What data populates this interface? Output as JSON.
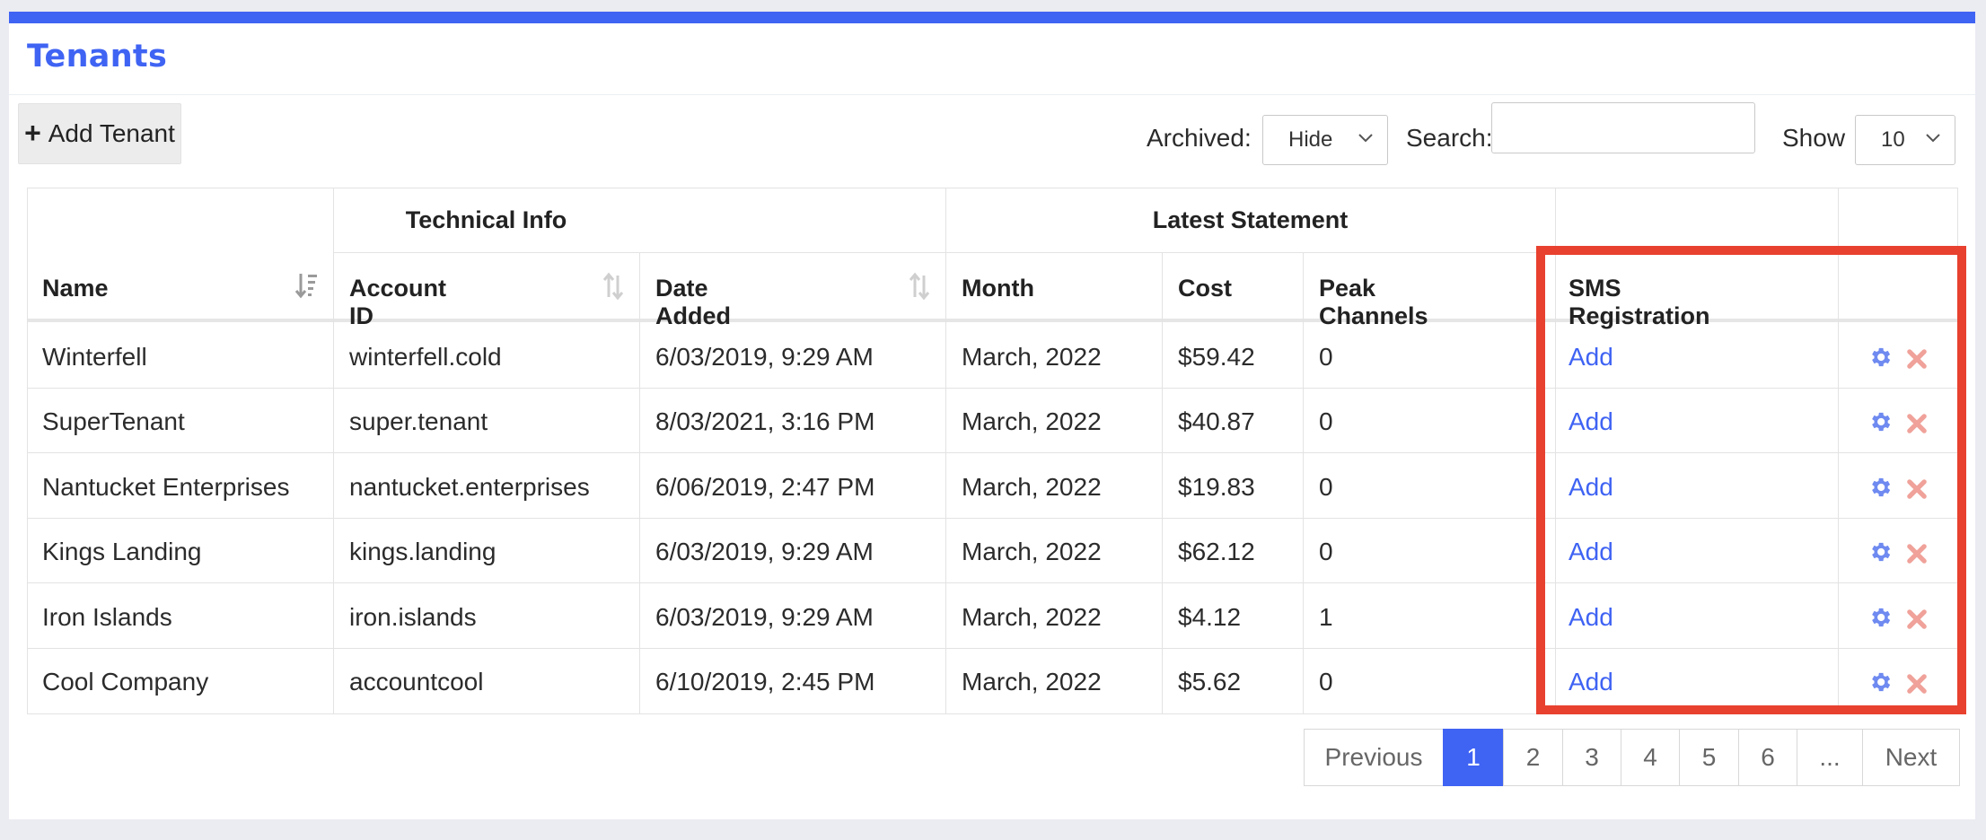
{
  "page": {
    "title": "Tenants"
  },
  "toolbar": {
    "add_label": "Add Tenant",
    "archived_label": "Archived:",
    "archived_value": "Hide",
    "search_label": "Search:",
    "search_value": "",
    "show_label": "Show",
    "show_value": "10"
  },
  "table": {
    "group_headers": {
      "technical": "Technical Info",
      "statement": "Latest Statement"
    },
    "columns": {
      "name": "Name",
      "account_id": "Account ID",
      "date_added": "Date Added",
      "month": "Month",
      "cost": "Cost",
      "peak_channels": "Peak Channels",
      "sms_registration": "SMS Registration"
    },
    "rows": [
      {
        "name": "Winterfell",
        "account_id": "winterfell.cold",
        "date_added": "6/03/2019, 9:29 AM",
        "month": "March, 2022",
        "cost": "$59.42",
        "peak": "0",
        "sms": "Add"
      },
      {
        "name": "SuperTenant",
        "account_id": "super.tenant",
        "date_added": "8/03/2021, 3:16 PM",
        "month": "March, 2022",
        "cost": "$40.87",
        "peak": "0",
        "sms": "Add"
      },
      {
        "name": "Nantucket Enterprises",
        "account_id": "nantucket.enterprises",
        "date_added": "6/06/2019, 2:47 PM",
        "month": "March, 2022",
        "cost": "$19.83",
        "peak": "0",
        "sms": "Add"
      },
      {
        "name": "Kings Landing",
        "account_id": "kings.landing",
        "date_added": "6/03/2019, 9:29 AM",
        "month": "March, 2022",
        "cost": "$62.12",
        "peak": "0",
        "sms": "Add"
      },
      {
        "name": "Iron Islands",
        "account_id": "iron.islands",
        "date_added": "6/03/2019, 9:29 AM",
        "month": "March, 2022",
        "cost": "$4.12",
        "peak": "1",
        "sms": "Add"
      },
      {
        "name": "Cool Company",
        "account_id": "accountcool",
        "date_added": "6/10/2019, 2:45 PM",
        "month": "March, 2022",
        "cost": "$5.62",
        "peak": "0",
        "sms": "Add"
      }
    ]
  },
  "pagination": {
    "previous": "Previous",
    "pages": [
      "1",
      "2",
      "3",
      "4",
      "5",
      "6",
      "..."
    ],
    "active": "1",
    "next": "Next"
  },
  "colors": {
    "accent": "#3f63f3",
    "highlight": "#e8412f",
    "gear": "#6f8af0",
    "delete": "#f0a29a"
  },
  "icons": {
    "sort_active": "sort-desc-icon",
    "sort": "sort-icon",
    "settings": "gear-icon",
    "delete": "close-icon",
    "add": "plus-icon",
    "dropdown": "chevron-down-icon"
  }
}
